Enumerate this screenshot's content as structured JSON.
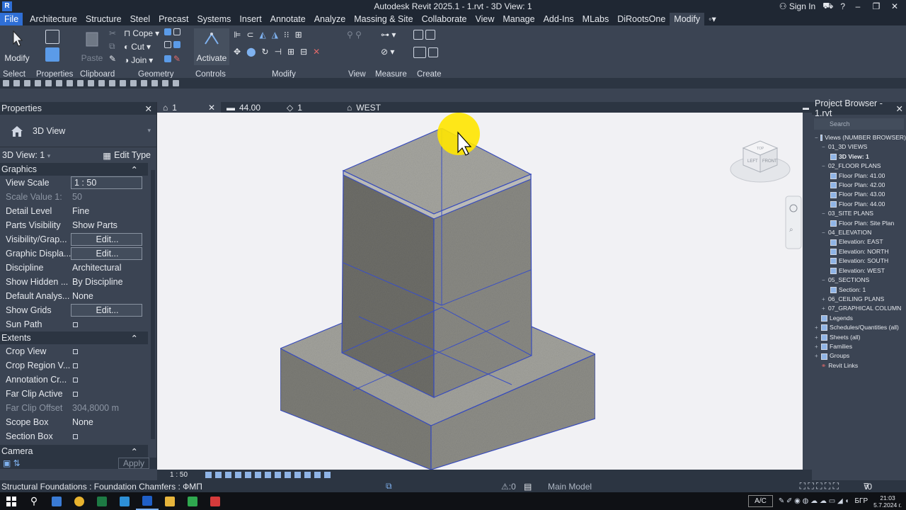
{
  "window": {
    "app_logo": "R",
    "title": "Autodesk Revit 2025.1 - 1.rvt - 3D View: 1",
    "sign_in": "Sign In",
    "help": "?"
  },
  "ribbon_tabs": [
    "File",
    "Architecture",
    "Structure",
    "Steel",
    "Precast",
    "Systems",
    "Insert",
    "Annotate",
    "Analyze",
    "Massing & Site",
    "Collaborate",
    "View",
    "Manage",
    "Add-Ins",
    "MLabs",
    "DiRootsOne",
    "Modify"
  ],
  "ribbon": {
    "modify_button": "Modify",
    "paste_button": "Paste",
    "cope": "Cope",
    "cut": "Cut",
    "join": "Join",
    "activate_button": "Activate",
    "groups": {
      "select": "Select",
      "properties": "Properties",
      "clipboard": "Clipboard",
      "geometry": "Geometry",
      "controls": "Controls",
      "modify": "Modify",
      "view": "View",
      "measure": "Measure",
      "create": "Create"
    }
  },
  "properties": {
    "panel_title": "Properties",
    "type_name": "3D View",
    "instance": "3D View: 1",
    "edit_type": "Edit Type",
    "sections": {
      "graphics": "Graphics",
      "extents": "Extents",
      "camera": "Camera"
    },
    "graphics_rows": [
      {
        "name": "View Scale",
        "value": "1 : 50"
      },
      {
        "name": "Scale Value   1:",
        "value": "50"
      },
      {
        "name": "Detail Level",
        "value": "Fine"
      },
      {
        "name": "Parts Visibility",
        "value": "Show Parts"
      },
      {
        "name": "Visibility/Grap...",
        "value": "Edit..."
      },
      {
        "name": "Graphic Displa...",
        "value": "Edit..."
      },
      {
        "name": "Discipline",
        "value": "Architectural"
      },
      {
        "name": "Show Hidden ...",
        "value": "By Discipline"
      },
      {
        "name": "Default Analys...",
        "value": "None"
      },
      {
        "name": "Show Grids",
        "value": "Edit..."
      },
      {
        "name": "Sun Path",
        "value": ""
      }
    ],
    "extents_rows": [
      {
        "name": "Crop View",
        "value": ""
      },
      {
        "name": "Crop Region V...",
        "value": ""
      },
      {
        "name": "Annotation Cr...",
        "value": ""
      },
      {
        "name": "Far Clip Active",
        "value": ""
      },
      {
        "name": "Far Clip Offset",
        "value": "304,8000 m"
      },
      {
        "name": "Scope Box",
        "value": "None"
      },
      {
        "name": "Section Box",
        "value": ""
      }
    ],
    "apply": "Apply"
  },
  "view_tabs": [
    {
      "label": "1"
    },
    {
      "label": "44.00"
    },
    {
      "label": "1"
    },
    {
      "label": "WEST"
    }
  ],
  "viewcube": {
    "left": "LEFT",
    "front": "FRONT",
    "top": "TOP"
  },
  "view_scale_label": "1 : 50",
  "project_browser": {
    "title": "Project Browser - 1.rvt",
    "search_placeholder": "Search",
    "root": "Views (NUMBER BROWSER)",
    "groups": [
      {
        "name": "01_3D VIEWS",
        "items": [
          "3D View: 1"
        ]
      },
      {
        "name": "02_FLOOR PLANS",
        "items": [
          "Floor Plan: 41.00",
          "Floor Plan: 42.00",
          "Floor Plan: 43.00",
          "Floor Plan: 44.00"
        ]
      },
      {
        "name": "03_SITE PLANS",
        "items": [
          "Floor Plan: Site Plan"
        ]
      },
      {
        "name": "04_ELEVATION",
        "items": [
          "Elevation: EAST",
          "Elevation: NORTH",
          "Elevation: SOUTH",
          "Elevation: WEST"
        ]
      },
      {
        "name": "05_SECTIONS",
        "items": [
          "Section: 1"
        ]
      },
      {
        "name": "06_CEILING PLANS",
        "items": []
      },
      {
        "name": "07_GRAPHICAL COLUMN",
        "items": []
      }
    ],
    "other": [
      "Legends",
      "Schedules/Quantities (all)",
      "Sheets (all)",
      "Families",
      "Groups",
      "Revit Links"
    ]
  },
  "status": {
    "selection": "Structural Foundations : Foundation Chamfers : ФМП",
    "warnings": ":0",
    "model": "Main Model",
    "filter_count": ":0"
  },
  "taskbar": {
    "ac": "A/C",
    "language": "БГР",
    "time": "21:03",
    "date": "5.7.2024 г."
  },
  "colors": {
    "accent": "#2f6fd6",
    "edge_blue": "#3a4fc4",
    "cursor_highlight": "#ffe600"
  }
}
